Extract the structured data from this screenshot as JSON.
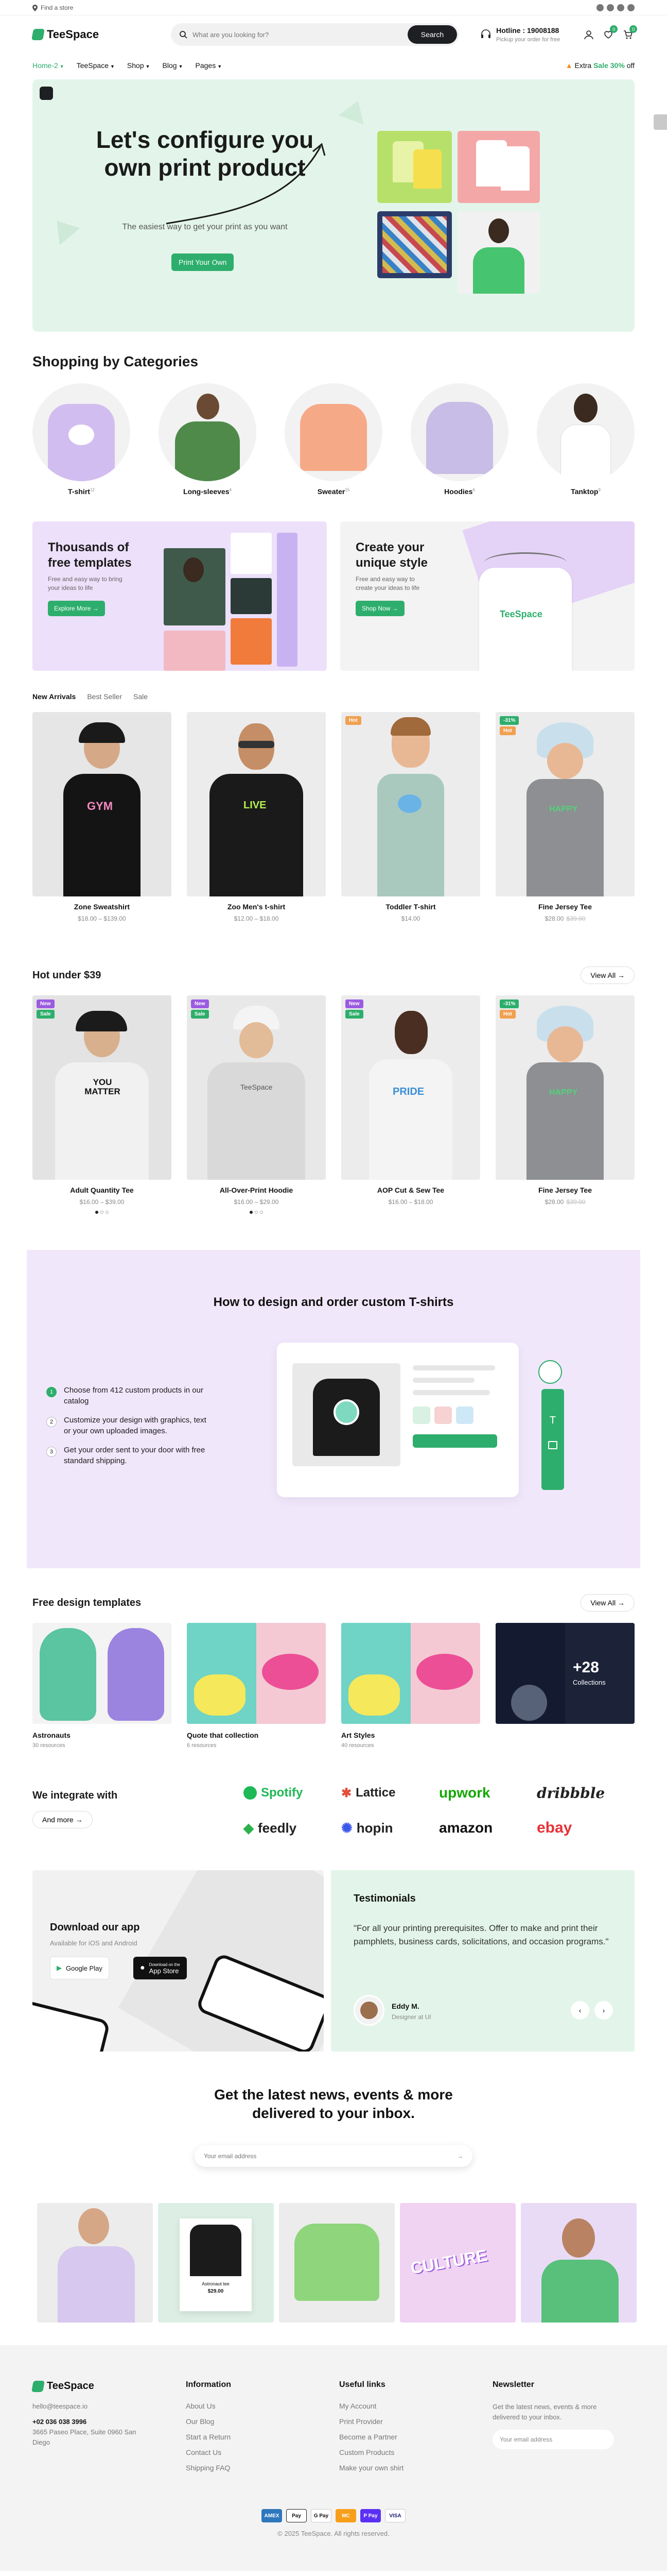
{
  "topbar": {
    "store_label": "Find a store"
  },
  "header": {
    "logo_text": "TeeSpace",
    "search_placeholder": "What are you looking for?",
    "search_button": "Search",
    "hotline_title": "Hotline : 19008188",
    "hotline_sub": "Pickup your order for free",
    "wishlist_count": "0",
    "cart_count": "0"
  },
  "nav": {
    "items": [
      "Home-2",
      "TeeSpace",
      "Shop",
      "Blog",
      "Pages"
    ],
    "extra_prefix": "Extra",
    "extra_highlight": "Sale 30%",
    "extra_suffix": "off"
  },
  "hero": {
    "title": "Let's configure you own print product",
    "subtitle": "The easiest way to get your print as you want",
    "button": "Print Your Own"
  },
  "categories": {
    "title": "Shopping by Categories",
    "items": [
      {
        "name": "T-shirt",
        "count": "12"
      },
      {
        "name": "Long-sleeves",
        "count": "4"
      },
      {
        "name": "Sweater",
        "count": "15"
      },
      {
        "name": "Hoodies",
        "count": "6"
      },
      {
        "name": "Tanktop",
        "count": "9"
      }
    ]
  },
  "promos": [
    {
      "title": "Thousands of free templates",
      "text": "Free and easy way to bring your ideas to life",
      "button": "Explore More"
    },
    {
      "title": "Create your unique style",
      "text": "Free and easy way to create your ideas to life",
      "button": "Shop Now",
      "shirt_text": "TeeSpace"
    }
  ],
  "product_tabs": [
    "New Arrivals",
    "Best Seller",
    "Sale"
  ],
  "new_arrivals": [
    {
      "name": "Zone Sweatshirt",
      "price": "$18.00 – $139.00",
      "old": "",
      "labels": [],
      "print": "GYM"
    },
    {
      "name": "Zoo Men's t-shirt",
      "price": "$12.00 – $18.00",
      "old": "",
      "labels": [],
      "print": "LIVE"
    },
    {
      "name": "Toddler T-shirt",
      "price": "$14.00",
      "old": "",
      "labels": [
        "Hot"
      ],
      "print": ""
    },
    {
      "name": "Fine Jersey Tee",
      "price": "$28.00",
      "old": "$39.00",
      "labels": [
        "-31%",
        "Hot"
      ],
      "print": "HAPPY"
    }
  ],
  "hot_under": {
    "title": "Hot under $39",
    "view_all": "View All",
    "items": [
      {
        "name": "Adult Quantity Tee",
        "price": "$16.00 – $39.00",
        "old": "",
        "labels": [
          "New",
          "Sale"
        ],
        "print": "YOU MATTER"
      },
      {
        "name": "All-Over-Print Hoodie",
        "price": "$16.00 – $29.00",
        "old": "",
        "labels": [
          "New",
          "Sale"
        ],
        "print": "TeeSpace"
      },
      {
        "name": "AOP Cut & Sew Tee",
        "price": "$16.00 – $18.00",
        "old": "",
        "labels": [
          "New",
          "Sale"
        ],
        "print": "PRIDE"
      },
      {
        "name": "Fine Jersey Tee",
        "price": "$28.00",
        "old": "$39.00",
        "labels": [
          "-31%",
          "Hot"
        ],
        "print": "HAPPY"
      }
    ]
  },
  "howto": {
    "title": "How to design and order custom T-shirts",
    "steps": [
      {
        "n": "1",
        "text": "Choose from 412 custom products in our catalog"
      },
      {
        "n": "2",
        "text": "Customize your design with graphics, text or your own uploaded images."
      },
      {
        "n": "3",
        "text": "Get your order sent to your door with free standard shipping."
      }
    ]
  },
  "templates": {
    "title": "Free design templates",
    "view_all": "View All",
    "items": [
      {
        "name": "Astronauts",
        "sub": "30 resources"
      },
      {
        "name": "Quote that collection",
        "sub": "6 resources"
      },
      {
        "name": "Art Styles",
        "sub": "40 resources"
      },
      {
        "name": "",
        "sub": "",
        "more": "+28",
        "more_label": "Collections"
      }
    ]
  },
  "integrate": {
    "title": "We integrate with",
    "button": "And more",
    "brands": [
      "Spotify",
      "Lattice",
      "upwork",
      "dribbble",
      "feedly",
      "hopin",
      "amazon",
      "ebay"
    ]
  },
  "app": {
    "title": "Download our app",
    "sub": "Available for iOS and Android",
    "google": "Google Play",
    "apple_small": "Download on the",
    "apple": "App Store"
  },
  "testimonial": {
    "title": "Testimonials",
    "quote": "\"For all your printing prerequisites. Offer to make and print their pamphlets, business cards, solicitations, and occasion programs.\"",
    "author": "Eddy M.",
    "role": "Designer at UI"
  },
  "newsletter": {
    "title": "Get the latest news, events & more delivered to your inbox.",
    "placeholder": "Your email address"
  },
  "gallery": {
    "price_card_price": "$29.00",
    "price_card_name": "Astronaut tee",
    "culture": "CULTURE"
  },
  "footer": {
    "logo_text": "TeeSpace",
    "email": "hello@teespace.io",
    "phone": "+02 036 038 3996",
    "address": "3665 Paseo Place, Suite 0960 San Diego",
    "info_title": "Information",
    "info_links": [
      "About Us",
      "Our Blog",
      "Start a Return",
      "Contact Us",
      "Shipping FAQ"
    ],
    "useful_title": "Useful links",
    "useful_links": [
      "My Account",
      "Print Provider",
      "Become a Partner",
      "Custom Products",
      "Make your own shirt"
    ],
    "newsletter_title": "Newsletter",
    "newsletter_text": "Get the latest news, events & more delivered to your inbox.",
    "newsletter_placeholder": "Your email address",
    "payments": [
      "AMEX",
      "Pay",
      "G Pay",
      "MC",
      "P Pay",
      "VISA"
    ],
    "copyright": "© 2025 TeeSpace. All rights reserved."
  },
  "colors": {
    "accent": "#2eae6c",
    "mint": "#e3f5ea",
    "lavender": "#f1e7fb",
    "dark": "#1e1f22"
  }
}
